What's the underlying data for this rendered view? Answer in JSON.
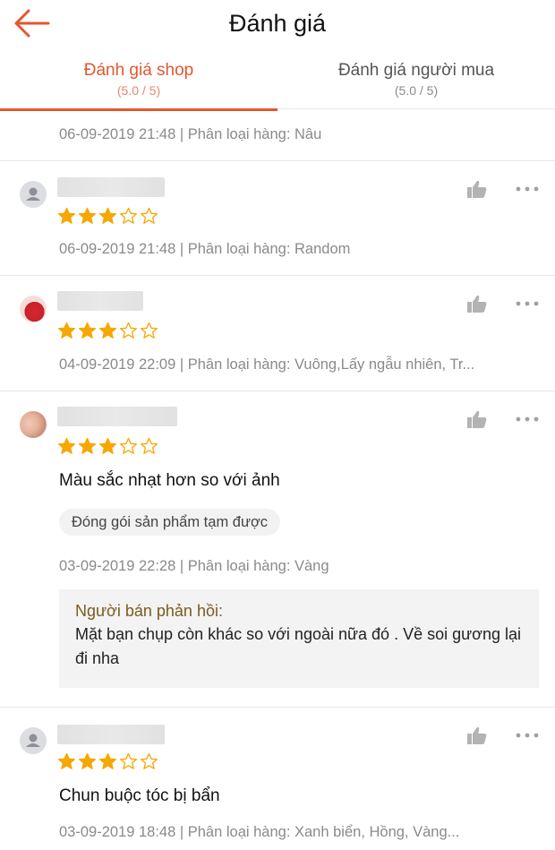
{
  "header": {
    "title": "Đánh giá",
    "back_icon": "arrow-left-icon"
  },
  "tabs": [
    {
      "label": "Đánh giá shop",
      "sub": "(5.0 / 5)",
      "active": true
    },
    {
      "label": "Đánh giá người mua",
      "sub": "(5.0 / 5)",
      "active": false
    }
  ],
  "colors": {
    "accent": "#e3572f",
    "star": "#f6a700",
    "meta": "#8a8a8a",
    "reply_title": "#7d5a1e"
  },
  "top_partial": {
    "meta": "06-09-2019 21:48 | Phân loại hàng: Nâu"
  },
  "reviews": [
    {
      "avatar": "default-avatar",
      "rating": 3,
      "max_rating": 5,
      "meta": "06-09-2019 21:48 | Phân loại hàng: Random"
    },
    {
      "avatar": "photo-avatar",
      "rating": 3,
      "max_rating": 5,
      "meta": "04-09-2019 22:09 | Phân loại hàng: Vuông,Lấy ngẫu nhiên, Tr..."
    },
    {
      "avatar": "photo-avatar",
      "rating": 3,
      "max_rating": 5,
      "comment": "Màu sắc nhạt hơn so với ảnh",
      "tag": "Đóng gói sản phẩm tạm được",
      "meta": "03-09-2019 22:28 | Phân loại hàng: Vàng",
      "seller_reply": {
        "title": "Người bán phản hồi:",
        "text": "Mặt bạn chụp còn khác so với ngoài nữa đó . Về soi gương lại đi nha"
      }
    },
    {
      "avatar": "default-avatar",
      "rating": 3,
      "max_rating": 5,
      "comment": "Chun buộc tóc bị bẩn",
      "meta": "03-09-2019 18:48 | Phân loại hàng: Xanh biển, Hồng, Vàng..."
    }
  ]
}
